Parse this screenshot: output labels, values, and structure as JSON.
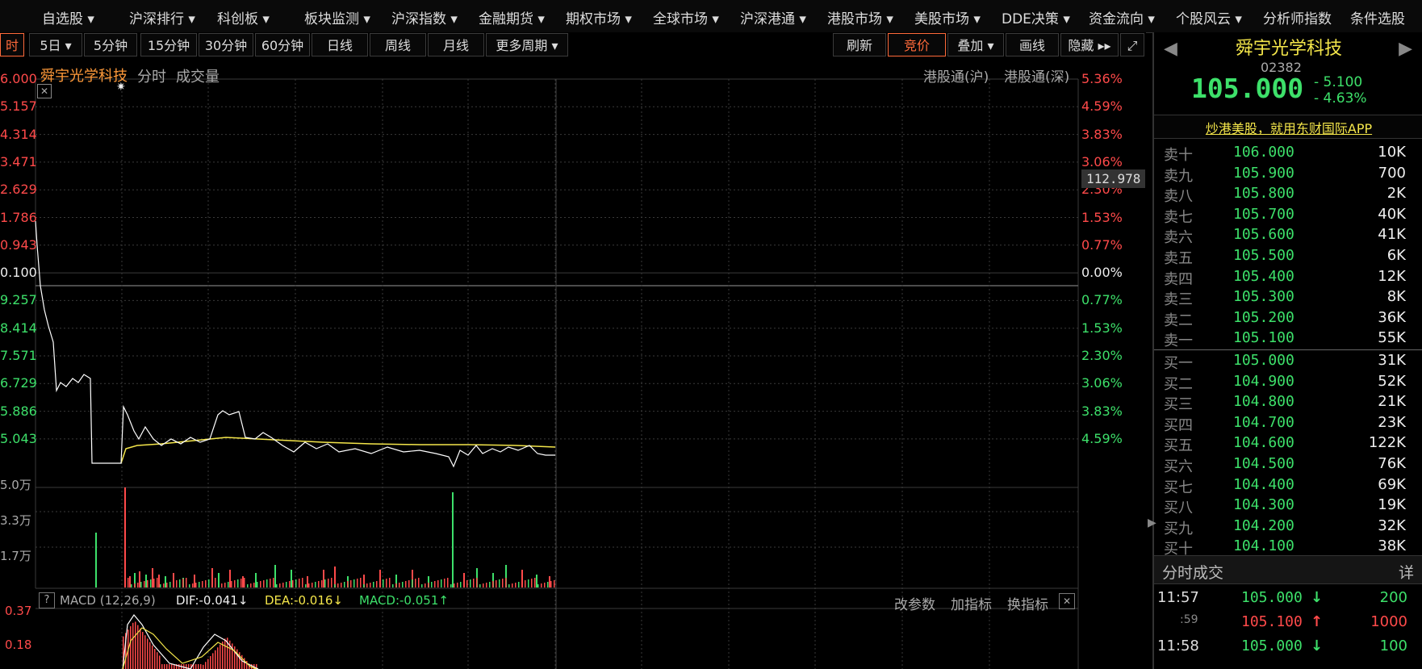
{
  "top_menu": [
    "自选股",
    "沪深排行",
    "科创板",
    "板块监测",
    "沪深指数",
    "金融期货",
    "期权市场",
    "全球市场",
    "沪深港通",
    "港股市场",
    "美股市场",
    "DDE决策",
    "资金流向",
    "个股风云",
    "分析师指数",
    "条件选股"
  ],
  "period_tabs": [
    "时",
    "5日",
    "5分钟",
    "15分钟",
    "30分钟",
    "60分钟",
    "日线",
    "周线",
    "月线",
    "更多周期"
  ],
  "toolbar_right": {
    "refresh": "刷新",
    "bid": "竞价",
    "overlay": "叠加",
    "draw": "画线",
    "hide": "隐藏"
  },
  "chart": {
    "stock_name": "舜宇光学科技",
    "mode": "分时",
    "volume_label": "成交量",
    "connect_sh": "港股通(沪)",
    "connect_sz": "港股通(深)",
    "price_labels": [
      "6.000",
      "5.157",
      "4.314",
      "3.471",
      "2.629",
      "1.786",
      "0.943",
      "0.100",
      "9.257",
      "8.414",
      "7.571",
      "6.729",
      "5.886",
      "5.043"
    ],
    "pct_labels": [
      "5.36%",
      "4.59%",
      "3.83%",
      "3.06%",
      "2.30%",
      "1.53%",
      "0.77%",
      "0.00%",
      "0.77%",
      "1.53%",
      "2.30%",
      "3.06%",
      "3.83%",
      "4.59%"
    ],
    "cursor_value": "112.978",
    "volume_labels": [
      "5.0万",
      "3.3万",
      "1.7万"
    ],
    "indicator": {
      "help": "?",
      "name": "MACD (12,26,9)",
      "dif": "DIF:-0.041↓",
      "dea": "DEA:-0.016↓",
      "macd": "MACD:-0.051↑",
      "modify": "改参数",
      "add": "加指标",
      "switch": "换指标"
    },
    "macd_labels": [
      "0.37",
      "0.18"
    ]
  },
  "quote": {
    "name": "舜宇光学科技",
    "code": "02382",
    "price": "105.000",
    "change": "- 5.100",
    "change_pct": "- 4.63%",
    "ad": "炒港美股，就用东财国际APP"
  },
  "order_book": {
    "asks": [
      {
        "name": "卖十",
        "price": "106.000",
        "vol": "10K"
      },
      {
        "name": "卖九",
        "price": "105.900",
        "vol": "700"
      },
      {
        "name": "卖八",
        "price": "105.800",
        "vol": "2K"
      },
      {
        "name": "卖七",
        "price": "105.700",
        "vol": "40K"
      },
      {
        "name": "卖六",
        "price": "105.600",
        "vol": "41K"
      },
      {
        "name": "卖五",
        "price": "105.500",
        "vol": "6K"
      },
      {
        "name": "卖四",
        "price": "105.400",
        "vol": "12K"
      },
      {
        "name": "卖三",
        "price": "105.300",
        "vol": "8K"
      },
      {
        "name": "卖二",
        "price": "105.200",
        "vol": "36K"
      },
      {
        "name": "卖一",
        "price": "105.100",
        "vol": "55K"
      }
    ],
    "bids": [
      {
        "name": "买一",
        "price": "105.000",
        "vol": "31K"
      },
      {
        "name": "买二",
        "price": "104.900",
        "vol": "52K"
      },
      {
        "name": "买三",
        "price": "104.800",
        "vol": "21K"
      },
      {
        "name": "买四",
        "price": "104.700",
        "vol": "23K"
      },
      {
        "name": "买五",
        "price": "104.600",
        "vol": "122K"
      },
      {
        "name": "买六",
        "price": "104.500",
        "vol": "76K"
      },
      {
        "name": "买七",
        "price": "104.400",
        "vol": "69K"
      },
      {
        "name": "买八",
        "price": "104.300",
        "vol": "19K"
      },
      {
        "name": "买九",
        "price": "104.200",
        "vol": "32K"
      },
      {
        "name": "买十",
        "price": "104.100",
        "vol": "38K"
      }
    ]
  },
  "trades": {
    "title": "分时成交",
    "detail": "详",
    "rows": [
      {
        "time": "11:57",
        "price": "105.000",
        "dir": "↓",
        "vol": "200"
      },
      {
        "time": ":59",
        "price": "105.100",
        "dir": "↑",
        "vol": "1000"
      },
      {
        "time": "11:58",
        "price": "105.000",
        "dir": "↓",
        "vol": "100"
      }
    ]
  },
  "colors": {
    "up": "#ff4a4a",
    "down": "#3de06a",
    "avg": "#f4e64a",
    "price_line": "#ffffff",
    "grid": "#3a3a3a"
  }
}
